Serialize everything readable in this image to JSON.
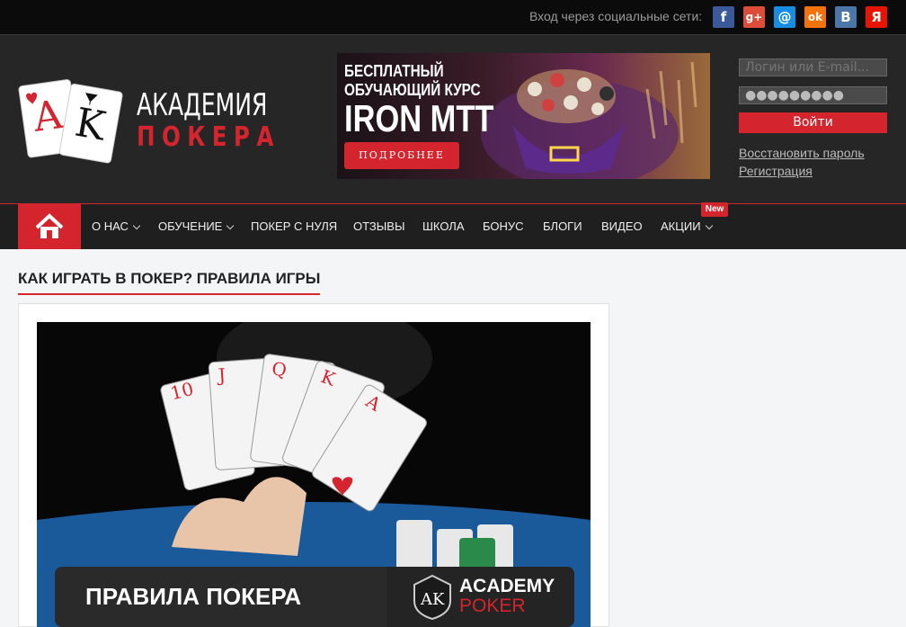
{
  "topbar": {
    "social_label": "Вход через социальные сети:",
    "icons": [
      {
        "name": "facebook-icon",
        "glyph": "f",
        "color": "#3b5998"
      },
      {
        "name": "google-plus-icon",
        "glyph": "g+",
        "color": "#dd4b39"
      },
      {
        "name": "mailru-icon",
        "glyph": "@",
        "color": "#168de2"
      },
      {
        "name": "odnoklassniki-icon",
        "glyph": "ok",
        "color": "#f2720c"
      },
      {
        "name": "vkontakte-icon",
        "glyph": "B",
        "color": "#4a76a8"
      },
      {
        "name": "yandex-icon",
        "glyph": "Я",
        "color": "#e61400"
      }
    ]
  },
  "logo": {
    "line1": "АКАДЕМИЯ",
    "line2": "ПОКЕРА"
  },
  "banner": {
    "line1": "БЕСПЛАТНЫЙ",
    "line2": "ОБУЧАЮЩИЙ КУРС",
    "line3": "IRON MTT",
    "button": "ПОДРОБНЕЕ"
  },
  "login": {
    "login_placeholder": "Логин или E-mail...",
    "password_value": "●●●●●●●●●",
    "submit": "Войти",
    "restore": "Восстановить пароль",
    "register": "Регистрация"
  },
  "nav": {
    "items": [
      {
        "label": "О НАС",
        "dropdown": true
      },
      {
        "label": "ОБУЧЕНИЕ",
        "dropdown": true
      },
      {
        "label": "ПОКЕР С НУЛЯ",
        "dropdown": false
      },
      {
        "label": "ОТЗЫВЫ",
        "dropdown": false
      },
      {
        "label": "ШКОЛА",
        "dropdown": false
      },
      {
        "label": "БОНУС",
        "dropdown": false
      },
      {
        "label": "БЛОГИ",
        "dropdown": false
      },
      {
        "label": "ВИДЕО",
        "dropdown": false
      },
      {
        "label": "АКЦИИ",
        "dropdown": true
      }
    ],
    "new_badge": "New"
  },
  "page": {
    "title": "КАК ИГРАТЬ В ПОКЕР? ПРАВИЛА ИГРЫ",
    "image_caption": "ПРАВИЛА ПОКЕРА",
    "image_brand1": "ACADEMY",
    "image_brand2": "POKER"
  },
  "colors": {
    "accent": "#d4242e",
    "dark": "#262626",
    "topbar": "#0b0b0b"
  }
}
